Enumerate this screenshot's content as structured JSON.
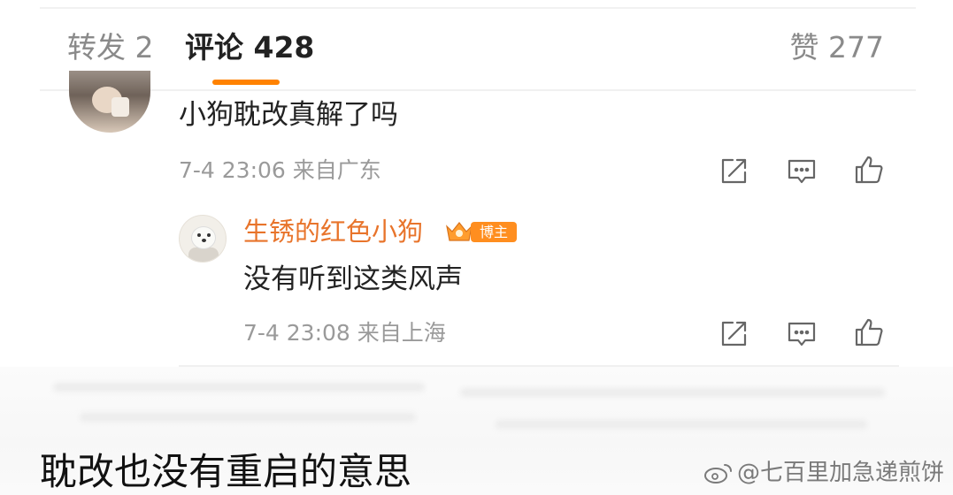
{
  "tabs": {
    "repost": "转发 2",
    "comments": "评论 428",
    "likes": "赞 277"
  },
  "comment": {
    "text": "小狗耽改真解了吗",
    "meta": "7-4 23:06  来自广东"
  },
  "reply": {
    "name": "生锈的红色小狗",
    "badge": "博主",
    "text": "没有听到这类风声",
    "meta": "7-4 23:08  来自上海"
  },
  "actions": [
    "share-edit-icon",
    "comment-icon",
    "like-icon"
  ],
  "caption": "耽改也没有重启的意思",
  "watermark": "@七百里加急递煎饼",
  "colors": {
    "accent": "#ff8200",
    "name": "#e8742b",
    "muted": "#9a9a9a"
  }
}
